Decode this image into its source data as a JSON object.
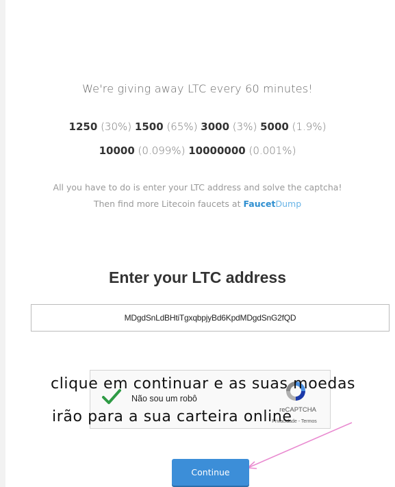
{
  "headline": "We're giving away LTC every 60 minutes!",
  "odds": {
    "row1": [
      {
        "amount": "1250",
        "pct": "(30%)"
      },
      {
        "amount": "1500",
        "pct": "(65%)"
      },
      {
        "amount": "3000",
        "pct": "(3%)"
      },
      {
        "amount": "5000",
        "pct": "(1.9%)"
      }
    ],
    "row2": [
      {
        "amount": "10000",
        "pct": "(0.099%)"
      },
      {
        "amount": "10000000",
        "pct": "(0.001%)"
      }
    ]
  },
  "info": {
    "line1": "All you have to do is enter your LTC address and solve the captcha!",
    "line2_prefix": "Then find more Litecoin faucets at ",
    "brand_part1": "Faucet",
    "brand_part2": "Dump"
  },
  "form": {
    "title": "Enter your LTC address",
    "address_value": "MDgdSnLdBHtiTgxqbpjyBd6KpdMDgdSnG2fQD"
  },
  "captcha": {
    "label": "Não sou um robô",
    "brand": "reCAPTCHA",
    "links": "Privacidade - Termos"
  },
  "overlay": {
    "line1": "clique em continuar e as suas moedas",
    "line2": "irão para a sua carteira online"
  },
  "button": {
    "continue_label": "Continue"
  },
  "colors": {
    "button_bg": "#3c8ed8",
    "check_green": "#2e9a45",
    "arrow_pink": "#e98ad0",
    "brand_blue": "#2f8fd0"
  }
}
